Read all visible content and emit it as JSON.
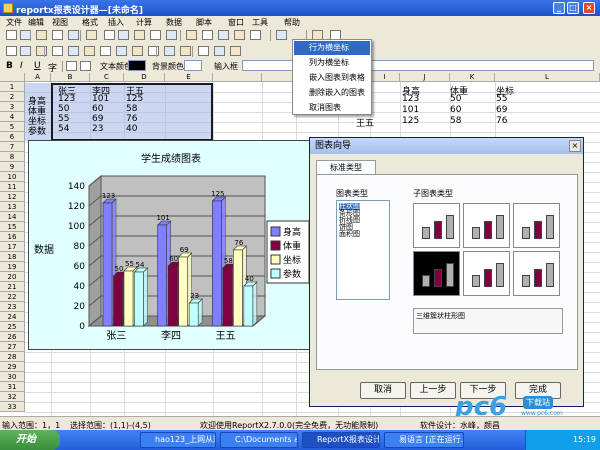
{
  "window": {
    "title": "reportx报表设计器—[未命名]"
  },
  "menu": [
    "文件",
    "编辑",
    "视图",
    "格式",
    "插入",
    "计算",
    "数据",
    "脚本",
    "窗口",
    "工具",
    "帮助"
  ],
  "formatbar": {
    "text_color_label": "文本颜色",
    "bg_color_label": "背景颜色",
    "input_label": "输入框"
  },
  "columns": [
    "A",
    "B",
    "C",
    "D",
    "E",
    "",
    "",
    "",
    "H",
    "I",
    "J",
    "K",
    "L"
  ],
  "rows": [
    "1",
    "2",
    "3",
    "4",
    "5",
    "6",
    "7",
    "8",
    "9",
    "10",
    "11",
    "12",
    "13",
    "14",
    "15",
    "16",
    "17",
    "18",
    "19",
    "20",
    "21",
    "22",
    "23",
    "24",
    "25",
    "26",
    "27",
    "28",
    "29",
    "30",
    "31",
    "32",
    "33"
  ],
  "table_left": {
    "header": [
      "",
      "张三",
      "李四",
      "王五"
    ],
    "rows": [
      [
        "身高",
        "123",
        "101",
        "125"
      ],
      [
        "体重",
        "50",
        "60",
        "58"
      ],
      [
        "坐标",
        "55",
        "69",
        "76"
      ],
      [
        "参数",
        "54",
        "23",
        "40"
      ]
    ]
  },
  "table_right": {
    "header": [
      "",
      "身高",
      "体重",
      "坐标"
    ],
    "rows": [
      [
        "三",
        "123",
        "50",
        "55"
      ],
      [
        "四",
        "101",
        "60",
        "69"
      ],
      [
        "王五",
        "125",
        "58",
        "76"
      ]
    ]
  },
  "context_menu": [
    "行为横坐标",
    "列为横坐标",
    "嵌入图表到表格",
    "删除嵌入的图表",
    "取消图表"
  ],
  "chart_data": {
    "type": "bar",
    "title": "学生成绩图表",
    "ylabel": "数据",
    "xlabel": "",
    "categories": [
      "张三",
      "李四",
      "王五"
    ],
    "ylim": [
      0,
      140
    ],
    "yticks": [
      "140",
      "120",
      "100",
      "80",
      "60",
      "40",
      "20",
      "0"
    ],
    "legend_position": "right",
    "grid": true,
    "series": [
      {
        "name": "身高",
        "values": [
          123,
          101,
          125
        ],
        "color": "#8080ff"
      },
      {
        "name": "体重",
        "values": [
          50,
          60,
          58
        ],
        "color": "#800040"
      },
      {
        "name": "坐标",
        "values": [
          55,
          69,
          76
        ],
        "color": "#ffffc0"
      },
      {
        "name": "参数",
        "values": [
          54,
          23,
          40
        ],
        "color": "#c0ffff"
      }
    ],
    "data_labels": [
      "123",
      "50",
      "55",
      "54",
      "101",
      "60",
      "69",
      "23",
      "125",
      "58",
      "76",
      "40"
    ]
  },
  "dialog": {
    "title": "图表向导",
    "tab": "标准类型",
    "chart_types_label": "图表类型",
    "chart_types": [
      "柱状图",
      "条形图",
      "折线图",
      "饼图",
      "面积图"
    ],
    "subtypes_label": "子图表类型",
    "description": "三维簇状柱形图",
    "buttons": {
      "cancel": "取消",
      "prev": "上一步",
      "next": "下一步",
      "finish": "完成"
    }
  },
  "status": {
    "input_range": "输入范围：1，1",
    "select_range": "选择范围：(1,1)-(4,5)",
    "welcome": "欢迎使用ReportX2.7.0.0(完全免费，无功能限制)",
    "designer": "软件设计：水峰，颜昌"
  },
  "taskbar": {
    "start": "开始",
    "tasks": [
      "hao123_上网从这...",
      "C:\\Documents and...",
      "ReportX报表设计...",
      "易语言 [正在运行..."
    ],
    "time": "15:19"
  },
  "watermark": {
    "brand": "pc6",
    "sub": "下载站",
    "url": "www.pc6.com"
  }
}
